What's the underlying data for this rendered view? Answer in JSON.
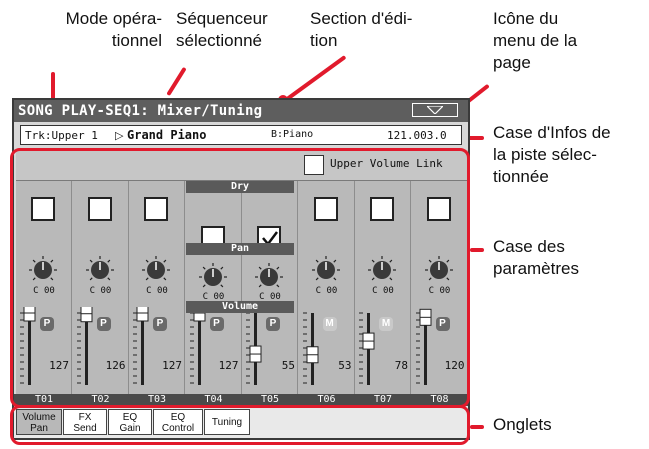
{
  "callouts": {
    "mode_line1": "Mode opéra-",
    "mode_line2": "tionnel",
    "seq_line1": "Séquenceur",
    "seq_line2": "sélectionné",
    "edit_line1": "Section d'édi-",
    "edit_line2": "tion",
    "menu_line1": "Icône du",
    "menu_line2": "menu de la",
    "menu_line3": "page",
    "track_line1": "Case d'Infos de",
    "track_line2": "la piste sélec-",
    "track_line3": "tionnée",
    "param_line1": "Case des",
    "param_line2": "paramètres",
    "tabs_label": "Onglets"
  },
  "screen": {
    "title": "SONG PLAY-SEQ1: Mixer/Tuning",
    "track_info": {
      "track": "Trk:Upper 1",
      "arrow": "▷",
      "sound": "Grand Piano",
      "bank": "B:Piano",
      "program": "121.003.0"
    },
    "upper_volume_link": "Upper Volume Link",
    "section_dry": "Dry",
    "section_pan": "Pan",
    "section_volume": "Volume",
    "channels": [
      {
        "label": "T01",
        "pan": "C 00",
        "volume": "127",
        "checked": false,
        "mode": "P",
        "level": 1.0
      },
      {
        "label": "T02",
        "pan": "C 00",
        "volume": "126",
        "checked": false,
        "mode": "P",
        "level": 0.99
      },
      {
        "label": "T03",
        "pan": "C 00",
        "volume": "127",
        "checked": false,
        "mode": "P",
        "level": 1.0
      },
      {
        "label": "T04",
        "pan": "C 00",
        "volume": "127",
        "checked": false,
        "mode": "P",
        "level": 1.0
      },
      {
        "label": "T05",
        "pan": "C 00",
        "volume": "55",
        "checked": true,
        "mode": "P",
        "level": 0.43
      },
      {
        "label": "T06",
        "pan": "C 00",
        "volume": "53",
        "checked": false,
        "mode": "M",
        "level": 0.42
      },
      {
        "label": "T07",
        "pan": "C 00",
        "volume": "78",
        "checked": false,
        "mode": "M",
        "level": 0.61
      },
      {
        "label": "T08",
        "pan": "C 00",
        "volume": "120",
        "checked": false,
        "mode": "P",
        "level": 0.94
      }
    ],
    "tabs": [
      {
        "line1": "Volume",
        "line2": "Pan",
        "selected": true
      },
      {
        "line1": "FX",
        "line2": "Send",
        "selected": false
      },
      {
        "line1": "EQ",
        "line2": "Gain",
        "selected": false
      },
      {
        "line1": "EQ",
        "line2": "Control",
        "selected": false
      },
      {
        "line1": "Tuning",
        "line2": "",
        "selected": false
      }
    ]
  },
  "colors": {
    "accent_red": "#e11a2c",
    "title_bar": "#5e5e5e",
    "mute_badge": "#c9c9c9",
    "play_badge": "#6a6a6a"
  }
}
